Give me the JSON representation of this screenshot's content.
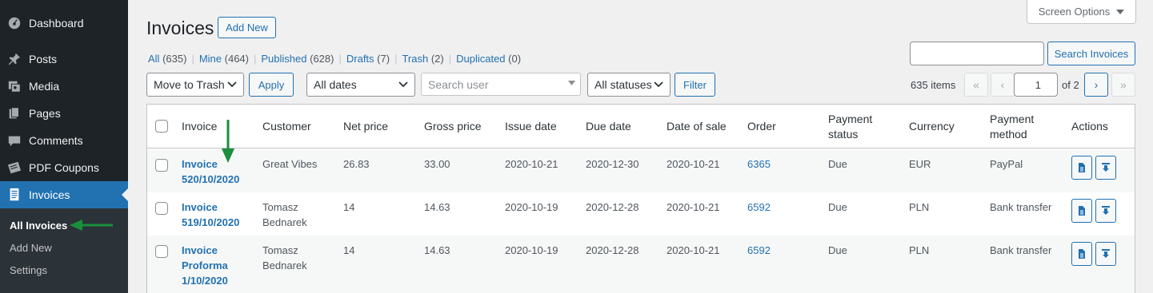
{
  "sidebar": {
    "items": [
      {
        "label": "Dashboard",
        "icon": "dashboard-icon"
      },
      {
        "label": "Posts",
        "icon": "pin-icon"
      },
      {
        "label": "Media",
        "icon": "media-icon"
      },
      {
        "label": "Pages",
        "icon": "pages-icon"
      },
      {
        "label": "Comments",
        "icon": "comment-icon"
      },
      {
        "label": "PDF Coupons",
        "icon": "coupons-icon"
      },
      {
        "label": "Invoices",
        "icon": "invoice-icon"
      }
    ],
    "submenu": [
      {
        "label": "All Invoices"
      },
      {
        "label": "Add New"
      },
      {
        "label": "Settings"
      }
    ]
  },
  "header": {
    "title": "Invoices",
    "add_new": "Add New",
    "screen_options": "Screen Options"
  },
  "views": {
    "all": {
      "label": "All",
      "count": "(635)"
    },
    "mine": {
      "label": "Mine",
      "count": "(464)"
    },
    "published": {
      "label": "Published",
      "count": "(628)"
    },
    "drafts": {
      "label": "Drafts",
      "count": "(7)"
    },
    "trash": {
      "label": "Trash",
      "count": "(2)"
    },
    "duplicated": {
      "label": "Duplicated",
      "count": "(0)"
    }
  },
  "search": {
    "value": "",
    "button": "Search Invoices"
  },
  "filters": {
    "bulk_action": "Move to Trash",
    "apply": "Apply",
    "dates": "All dates",
    "user_placeholder": "Search user",
    "statuses": "All statuses",
    "filter": "Filter"
  },
  "pagination": {
    "items": "635 items",
    "first": "«",
    "prev": "‹",
    "current": "1",
    "of": "of 2",
    "next": "›",
    "last": "»"
  },
  "table": {
    "headers": {
      "invoice": "Invoice",
      "customer": "Customer",
      "net": "Net price",
      "gross": "Gross price",
      "issue": "Issue date",
      "due": "Due date",
      "sale": "Date of sale",
      "order": "Order",
      "payment_status_1": "Payment",
      "payment_status_2": "status",
      "currency": "Currency",
      "payment_method_1": "Payment",
      "payment_method_2": "method",
      "actions": "Actions"
    },
    "rows": [
      {
        "title_lines": [
          "Invoice",
          "520/10/2020"
        ],
        "customer_lines": [
          "Great Vibes"
        ],
        "net": "26.83",
        "gross": "33.00",
        "issue": "2020-10-21",
        "due": "2020-12-30",
        "sale": "2020-10-21",
        "order": "6365",
        "status": "Due",
        "currency": "EUR",
        "method": "PayPal"
      },
      {
        "title_lines": [
          "Invoice",
          "519/10/2020"
        ],
        "customer_lines": [
          "Tomasz",
          "Bednarek"
        ],
        "net": "14",
        "gross": "14.63",
        "issue": "2020-10-19",
        "due": "2020-12-28",
        "sale": "2020-10-21",
        "order": "6592",
        "status": "Due",
        "currency": "PLN",
        "method": "Bank transfer"
      },
      {
        "title_lines": [
          "Invoice",
          "Proforma",
          "1/10/2020"
        ],
        "customer_lines": [
          "Tomasz",
          "Bednarek"
        ],
        "net": "14",
        "gross": "14.63",
        "issue": "2020-10-19",
        "due": "2020-12-28",
        "sale": "2020-10-21",
        "order": "6592",
        "status": "Due",
        "currency": "PLN",
        "method": "Bank transfer"
      }
    ]
  },
  "colors": {
    "accent": "#2271b1",
    "sidebar": "#1d2327",
    "annotation_arrow": "#1a8f3c"
  }
}
